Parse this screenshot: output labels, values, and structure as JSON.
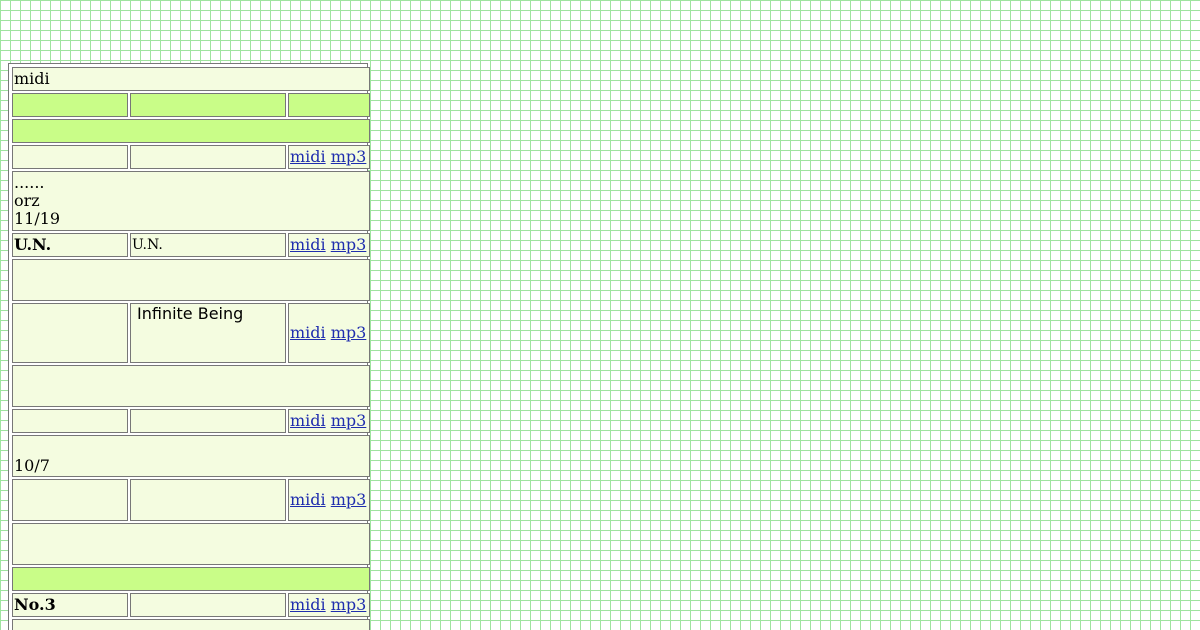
{
  "header": {
    "title": "midi"
  },
  "links": {
    "midi": "midi",
    "mp3": "mp3"
  },
  "rows": {
    "r1": {
      "name": "",
      "title": ""
    },
    "note1": {
      "line1": "......",
      "line2": "orz",
      "line3": "11/19"
    },
    "r2": {
      "name": "U.N.",
      "title": "U.N."
    },
    "r3": {
      "name": "",
      "title": "Infinite Being"
    },
    "r4": {
      "name": "",
      "title": ""
    },
    "note2": {
      "line1": "10/7"
    },
    "r5": {
      "name": "",
      "title": ""
    },
    "r6": {
      "name": "No.3",
      "title": ""
    }
  },
  "colors": {
    "grid_line": "#9fe39f",
    "cell_bg": "#f4fce0",
    "header_bg": "#c9fd88",
    "link": "#1f2dae"
  }
}
